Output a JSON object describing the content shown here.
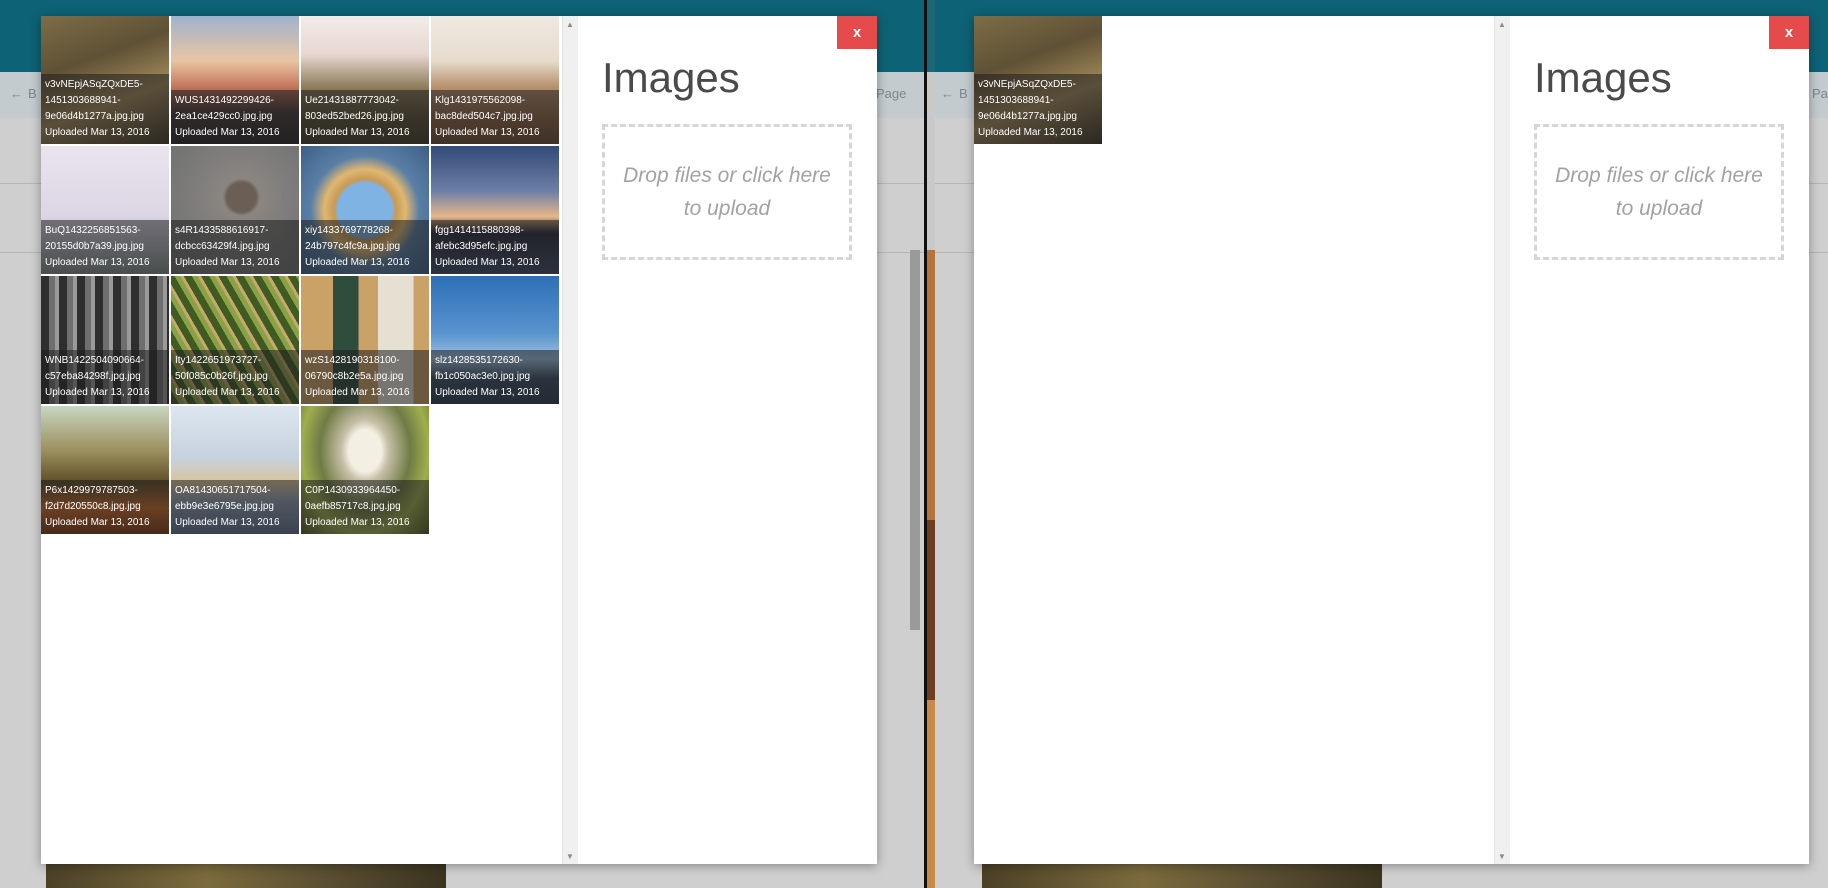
{
  "colors": {
    "accent": "#0e6275",
    "close": "#e64b4b"
  },
  "background": {
    "back_label": "B",
    "page_label": "Page",
    "page_label_partial": "Pa"
  },
  "left": {
    "close_label": "x",
    "title": "Images",
    "dropzone_text": "Drop files or click here to upload",
    "images": [
      {
        "name_line1": "v3vNEpjASqZQxDE5-",
        "name_line2": "1451303688941-",
        "name_line3": "9e06d4b1277a.jpg.jpg",
        "uploaded": "Uploaded Mar 13, 2016",
        "bg": "linear-gradient(160deg,#7d6d47 0%,#5f5135 35%,#a38a5c 65%,#3f3827 100%)"
      },
      {
        "name_line1": "WUS1431492299426-",
        "name_line2": "2ea1ce429cc0.jpg.jpg",
        "uploaded": "Uploaded Mar 13, 2016",
        "bg": "linear-gradient(180deg,#9fb3cc 0%,#e9c5a4 35%,#c5765c 55%,#4a3a3a 75%,#2b2628 100%)"
      },
      {
        "name_line1": "Ue21431887773042-",
        "name_line2": "803ed52bed26.jpg.jpg",
        "uploaded": "Uploaded Mar 13, 2016",
        "bg": "linear-gradient(180deg,#f1ece9 0%,#e7d7d1 30%,#8f7f5e 55%,#5b5036 80%,#433c2a 100%)"
      },
      {
        "name_line1": "Klg1431975562098-",
        "name_line2": "bac8ded504c7.jpg.jpg",
        "uploaded": "Uploaded Mar 13, 2016",
        "bg": "linear-gradient(180deg,#efe9e1 0%,#e6dccd 35%,#b89270 55%,#8b6344 80%,#6a4a33 100%)"
      },
      {
        "name_line1": "BuQ1432256851563-",
        "name_line2": "20155d0b7a39.jpg.jpg",
        "uploaded": "Uploaded Mar 13, 2016",
        "bg": "linear-gradient(180deg,#e9e4ee 0%,#dcd6e4 55%,#b5b8c4 75%,#7d8a86 100%)"
      },
      {
        "name_line1": "s4R1433588616917-",
        "name_line2": "dcbcc63429f4.jpg.jpg",
        "uploaded": "Uploaded Mar 13, 2016",
        "bg": "radial-gradient(circle at 55% 40%,#6a5e55 0 14%,#8b8580 18%,#7e7d7c 45%,#6d6d6d 100%)"
      },
      {
        "name_line1": "xiy1433769778268-",
        "name_line2": "24b797c4fc9a.jpg.jpg",
        "uploaded": "Uploaded Mar 13, 2016",
        "bg": "radial-gradient(circle at 50% 50%,#7fb3e4 0 30%,#c79a57 34%,#e0b770 45%,#5a7fa6 60%,#3d5f86 100%)"
      },
      {
        "name_line1": "fgg1414115880398-",
        "name_line2": "afebc3d95efc.jpg.jpg",
        "uploaded": "Uploaded Mar 13, 2016",
        "bg": "linear-gradient(180deg,#334b78 0%,#6b7ea6 35%,#e6b68a 55%,#2b2c3a 68%,#3c4a66 100%)"
      },
      {
        "name_line1": "WNB1422504090664-",
        "name_line2": "c57eba84298f.jpg.jpg",
        "uploaded": "Uploaded Mar 13, 2016",
        "bg": "repeating-linear-gradient(90deg,#2e2e2e 0 8px,#6f6f6f 8px 14px,#9a9a9a 14px 18px)"
      },
      {
        "name_line1": "Ity1422651973727-",
        "name_line2": "50f085c0b26f.jpg.jpg",
        "uploaded": "Uploaded Mar 13, 2016",
        "bg": "repeating-linear-gradient(60deg,#3f5a23 0 7px,#89a245 7px 12px,#c9a96b 12px 15px)"
      },
      {
        "name_line1": "wzS1428190318100-",
        "name_line2": "06790c8b2e5a.jpg.jpg",
        "uploaded": "Uploaded Mar 13, 2016",
        "bg": "linear-gradient(90deg,#caa166 0 25%,#2f4d3c 25% 45%,#caa166 45% 60%,#e5e0d2 60% 88%,#caa166 88%)"
      },
      {
        "name_line1": "slz1428535172630-",
        "name_line2": "fb1c050ac3e0.jpg.jpg",
        "uploaded": "Uploaded Mar 13, 2016",
        "bg": "linear-gradient(180deg,#2d6fb6 0%,#5a94cf 45%,#9ec0df 65%,#3a4f67 80%,#2b3c50 100%)"
      },
      {
        "name_line1": "P6x1429979787503-",
        "name_line2": "f2d7d20550c8.jpg.jpg",
        "uploaded": "Uploaded Mar 13, 2016",
        "bg": "linear-gradient(180deg,#c8d6c0 0%,#9b8f5e 35%,#5f4d27 60%,#c96a2c 80%,#7a3a15 100%)"
      },
      {
        "name_line1": "OA81430651717504-",
        "name_line2": "ebb9e3e6795e.jpg.jpg",
        "uploaded": "Uploaded Mar 13, 2016",
        "bg": "linear-gradient(180deg,#dde6ef 0%,#c6d2de 40%,#d8c49c 60%,#8d9cb3 75%,#5f7290 100%)"
      },
      {
        "name_line1": "C0P1430933964450-",
        "name_line2": "0aefb85717c8.jpg.jpg",
        "uploaded": "Uploaded Mar 13, 2016",
        "bg": "radial-gradient(ellipse at 50% 35%,#f3efe2 0 18%,#c7c0a8 26%,#6f7b45 50%,#9fae4e 70%,#4d5a25 100%)"
      }
    ]
  },
  "right": {
    "close_label": "x",
    "title": "Images",
    "dropzone_text": "Drop files or click here to upload",
    "images": [
      {
        "name_line1": "v3vNEpjASqZQxDE5-",
        "name_line2": "1451303688941-",
        "name_line3": "9e06d4b1277a.jpg.jpg",
        "uploaded": "Uploaded Mar 13, 2016",
        "bg": "linear-gradient(160deg,#7d6d47 0%,#5f5135 35%,#a38a5c 65%,#3f3827 100%)"
      }
    ]
  }
}
